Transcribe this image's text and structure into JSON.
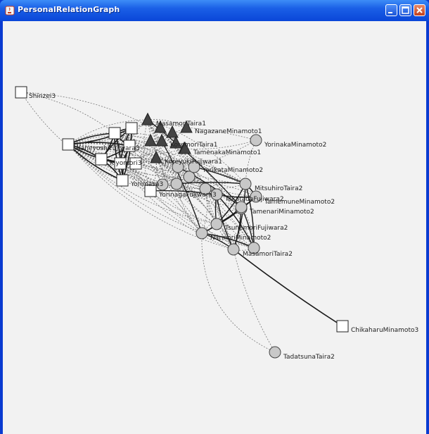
{
  "window": {
    "title": "PersonalRelationGraph"
  },
  "graph": {
    "nodes": [
      {
        "id": "Shinzei3",
        "label": "Shinzei3",
        "shape": "square"
      },
      {
        "id": "YorinakaMinamoto2",
        "label": "YorinakaMinamoto2",
        "shape": "circle"
      },
      {
        "id": "ChikaharuMinamoto3",
        "label": "ChikaharuMinamoto3",
        "shape": "square"
      },
      {
        "id": "TadatsunaTaira2",
        "label": "TadatsunaTaira2",
        "shape": "circle"
      },
      {
        "id": "MitsuhiroTaira2",
        "label": "MitsuhiroTaira2",
        "shape": "circle"
      },
      {
        "id": "TamemuneMinamoto2",
        "label": "TamemuneMinamoto2",
        "shape": "circle"
      },
      {
        "id": "TamenariMinamoto2",
        "label": "TamenariMinamoto2",
        "shape": "circle"
      },
      {
        "id": "TsunemoriFujiwara2",
        "label": "TsunemoriFujiwara2",
        "shape": "circle"
      },
      {
        "id": "NarinoriMinamoto2",
        "label": "NarinoriMinamoto2",
        "shape": "circle"
      },
      {
        "id": "MasamoriTaira2",
        "label": "MasamoriTaira2",
        "shape": "circle"
      },
      {
        "id": "YorikataMinamoto2",
        "label": "YorikataMinamoto2",
        "shape": "circle"
      },
      {
        "id": "TakatadaFujiwara2",
        "label": "TakatadaFujiwara2",
        "shape": "circle"
      },
      {
        "id": "TamenakaMinamoto1",
        "label": "TamenakaMinamoto1",
        "shape": "triangle"
      },
      {
        "id": "MasamoriTaira1",
        "label": "MasamoriTaira1",
        "shape": "triangle"
      },
      {
        "id": "NagazaneMinamoto1",
        "label": "NagazaneMinamoto1",
        "shape": "triangle"
      },
      {
        "id": "KoremoriTaira1",
        "label": "KoremoriTaira1",
        "shape": "triangle"
      },
      {
        "id": "KoreyukiFujiwara1",
        "label": "KoreyukiFujiwara1",
        "shape": "triangle"
      },
      {
        "id": "YorinagaFujiwara3",
        "label": "YorinagaFujiwara3",
        "shape": "square"
      },
      {
        "id": "KaneyoshiFujiwara3",
        "label": "KaneyoshiFujiwara3",
        "shape": "square"
      },
      {
        "id": "Kiyomori3",
        "label": "Kiyomori3",
        "shape": "square"
      },
      {
        "id": "Yorimasa3",
        "label": "Yorimasa3",
        "shape": "square"
      }
    ]
  }
}
